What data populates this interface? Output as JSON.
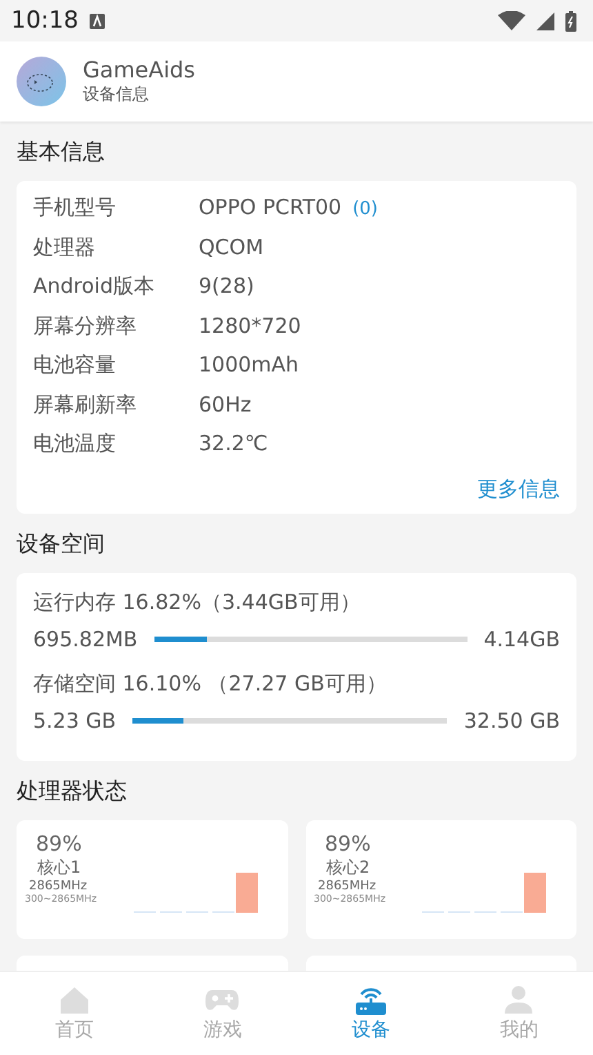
{
  "status_bar": {
    "time": "10:18"
  },
  "header": {
    "title": "GameAids",
    "subtitle": "设备信息"
  },
  "basic_info": {
    "title": "基本信息",
    "rows": [
      {
        "label": "手机型号",
        "value": "OPPO PCRT00",
        "extra": "(0)"
      },
      {
        "label": "处理器",
        "value": "QCOM"
      },
      {
        "label": "Android版本",
        "value": "9(28)"
      },
      {
        "label": "屏幕分辨率",
        "value": "1280*720"
      },
      {
        "label": "电池容量",
        "value": "1000mAh"
      },
      {
        "label": "屏幕刷新率",
        "value": "60Hz"
      },
      {
        "label": "电池温度",
        "value": "32.2℃"
      }
    ],
    "more_link": "更多信息"
  },
  "storage": {
    "title": "设备空间",
    "items": [
      {
        "caption": "运行内存 16.82%（3.44GB可用）",
        "used": "695.82MB",
        "level": 0.17,
        "total": "4.14GB"
      },
      {
        "caption": "存储空间 16.10% （27.27 GB可用）",
        "used": "5.23 GB",
        "level": 0.16,
        "total": "32.50 GB"
      }
    ]
  },
  "cpu": {
    "title": "处理器状态",
    "cores": [
      {
        "percent": "89%",
        "name": "核心1",
        "freq": "2865MHz",
        "range": "300~2865MHz"
      },
      {
        "percent": "89%",
        "name": "核心2",
        "freq": "2865MHz",
        "range": "300~2865MHz"
      },
      {
        "kind": "partial"
      },
      {
        "kind": "partial"
      }
    ]
  },
  "nav": [
    {
      "label": "首页",
      "kind": "home",
      "selected": false
    },
    {
      "label": "游戏",
      "kind": "gamepad",
      "selected": false
    },
    {
      "label": "设备",
      "kind": "router",
      "selected": true
    },
    {
      "label": "我的",
      "kind": "person",
      "selected": false
    }
  ]
}
